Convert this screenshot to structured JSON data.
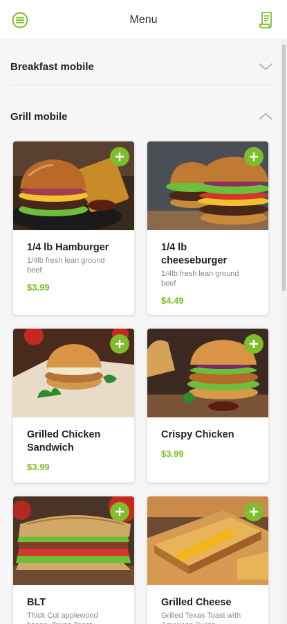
{
  "header": {
    "title": "Menu",
    "menu_icon": "menu-circle-icon",
    "cart_icon": "receipt-icon"
  },
  "sections": [
    {
      "label": "Breakfast mobile",
      "state": "collapsed"
    },
    {
      "label": "Grill mobile",
      "state": "expanded"
    }
  ],
  "items": [
    {
      "name": "1/4 lb Hamburger",
      "desc": "1/4lb fresh lean ground beef",
      "price": "$3.99"
    },
    {
      "name": "1/4 lb cheeseburger",
      "desc": "1/4lb fresh lean ground beef",
      "price": "$4.49"
    },
    {
      "name": "Grilled Chicken Sandwich",
      "desc": "",
      "price": "$3.99"
    },
    {
      "name": "Crispy Chicken",
      "desc": "",
      "price": "$3.99"
    },
    {
      "name": "BLT",
      "desc": "Thick Cut applewood bacon, Texas Toast",
      "price": ""
    },
    {
      "name": "Grilled Cheese",
      "desc": "Grilled Texas Toast with American Swiss",
      "price": ""
    }
  ],
  "colors": {
    "accent": "#7ebd2b",
    "background": "#f6f6f6"
  }
}
